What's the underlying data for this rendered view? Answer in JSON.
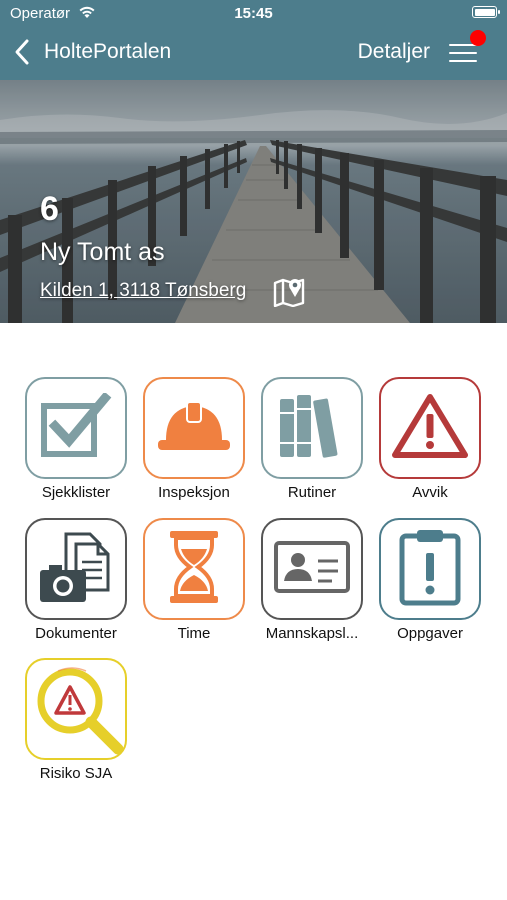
{
  "status_bar": {
    "carrier": "Operatør",
    "time": "15:45"
  },
  "nav": {
    "back_icon": "chevron-left-icon",
    "title": "HoltePortalen",
    "details_label": "Detaljer",
    "menu_icon": "hamburger-menu-icon",
    "has_notification": true
  },
  "project": {
    "number": "6",
    "name": "Ny Tomt as",
    "address": "Kilden 1, 3118 Tønsberg",
    "map_icon": "map-pin-icon"
  },
  "modules": [
    {
      "label": "Sjekklister",
      "icon": "checkbox-icon",
      "border": "#7f9ea3",
      "color": "#7f9ea3"
    },
    {
      "label": "Inspeksjon",
      "icon": "hard-hat-icon",
      "border": "#ee8a4a",
      "color": "#f08040"
    },
    {
      "label": "Rutiner",
      "icon": "binders-icon",
      "border": "#7f9ea3",
      "color": "#7f9ea3"
    },
    {
      "label": "Avvik",
      "icon": "warning-icon",
      "border": "#b53a3a",
      "color": "#b53a3a"
    },
    {
      "label": "Dokumenter",
      "icon": "documents-camera-icon",
      "border": "#555555",
      "color": "#3d4a4f"
    },
    {
      "label": "Time",
      "icon": "hourglass-icon",
      "border": "#ee8a4a",
      "color": "#f08040"
    },
    {
      "label": "Mannskapsl...",
      "icon": "id-card-icon",
      "border": "#555555",
      "color": "#666666"
    },
    {
      "label": "Oppgaver",
      "icon": "clipboard-alert-icon",
      "border": "#4d7d8c",
      "color": "#4d7d8c"
    },
    {
      "label": "Risiko SJA",
      "icon": "risk-magnifier-icon",
      "border": "#e6cf2a",
      "color": "#e6cf2a"
    }
  ],
  "colors": {
    "nav_background": "#4d7d8c",
    "notification": "#ff0000"
  }
}
